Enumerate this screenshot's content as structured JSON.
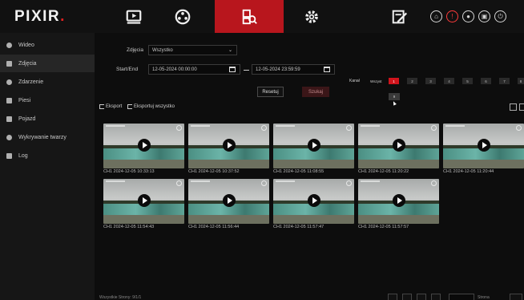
{
  "app": {
    "logo_text": "PIXIR",
    "logo_dot": "."
  },
  "nav": [
    {
      "name": "playback-icon"
    },
    {
      "name": "network-icon"
    },
    {
      "name": "search-media-icon",
      "active": true
    },
    {
      "name": "settings-gear-icon"
    },
    {
      "name": "edit-sign-icon"
    }
  ],
  "system_icons": [
    "lock-icon",
    "alert-icon",
    "user-icon",
    "save-icon",
    "power-icon"
  ],
  "sidebar": {
    "items": [
      {
        "label": "Wideo",
        "icon": "video-icon"
      },
      {
        "label": "Zdjęcia",
        "icon": "image-icon",
        "active": true
      },
      {
        "label": "Zdarzenie",
        "icon": "event-icon"
      },
      {
        "label": "Piesi",
        "icon": "pedestrian-icon"
      },
      {
        "label": "Pojazd",
        "icon": "car-icon"
      },
      {
        "label": "Wykrywanie twarzy",
        "icon": "face-detect-icon"
      },
      {
        "label": "Log",
        "icon": "log-icon"
      }
    ]
  },
  "filters": {
    "type_label": "Zdjęcia",
    "type_value": "Wszystko",
    "time_label": "Start/End",
    "start": "12-05-2024 00:00:00",
    "end": "12-05-2024 23:59:59",
    "reset_label": "Resetuj",
    "search_label": "Szukaj"
  },
  "channels": {
    "label": "Kanał",
    "all_label": "Wszyst",
    "items": [
      "1",
      "2",
      "3",
      "4",
      "5",
      "6",
      "7",
      "8"
    ],
    "active": "1",
    "popup": "9"
  },
  "actions": {
    "export_label": "Eksport",
    "export_all_label": "Eksportuj wszystko"
  },
  "results": [
    {
      "caption": "CH1 2024-12-05 10:33:13"
    },
    {
      "caption": "CH1 2024-12-05 10:37:52"
    },
    {
      "caption": "CH1 2024-12-05 11:08:55"
    },
    {
      "caption": "CH1 2024-12-05 11:20:22"
    },
    {
      "caption": "CH1 2024-12-05 11:20:44"
    },
    {
      "caption": "CH1 2024-12-05 11:54:43"
    },
    {
      "caption": "CH1 2024-12-05 11:56:44"
    },
    {
      "caption": "CH1 2024-12-05 11:57:47"
    },
    {
      "caption": "CH1 2024-12-05 11:57:57"
    }
  ],
  "footer": {
    "summary": "Wszystkie Strony: 9/1/1",
    "page_label": "Strona"
  },
  "colors": {
    "accent": "#b8161d",
    "channel_active": "#d0141c",
    "background": "#0d0d0d",
    "sidebar": "#161616"
  }
}
